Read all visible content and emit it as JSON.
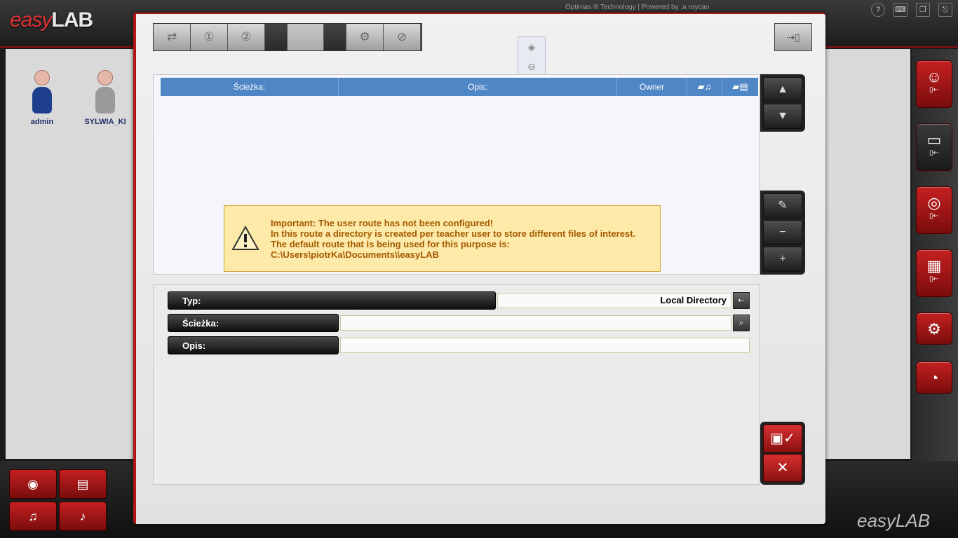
{
  "app": {
    "logo_easy": "easy",
    "logo_lab": "LAB",
    "credits": "Optimas ® Technology  |  Powered by ,a roycan",
    "bottom_logo": "easyLAB"
  },
  "desktop_users": [
    {
      "name": "admin",
      "body_color": "#1c3e8c"
    },
    {
      "name": "SYLWIA_KI",
      "body_color": "#9a9a9a"
    }
  ],
  "toolbar": {
    "buttons": [
      "users-swap-icon",
      "step-1-icon",
      "step-2-icon",
      "gear-icon",
      "gear-off-icon"
    ]
  },
  "grid": {
    "columns": [
      "Ścieżka:",
      "Opis:",
      "Owner"
    ],
    "header_color": "#4f86c6"
  },
  "warning": {
    "line1": "Important: The user route has not been configured!",
    "line2": "In this route a directory is created per teacher user to store different files of interest.",
    "line3": "The default route that is being used for this purpose is:",
    "line4": "C:\\Users\\piotrKa\\Documents\\\\easyLAB"
  },
  "form": {
    "typ_label": "Typ:",
    "typ_value": "Local Directory",
    "sciezka_label": "Ścieżka:",
    "sciezka_value": "",
    "opis_label": "Opis:",
    "opis_value": ""
  },
  "colors": {
    "accent_red": "#b01818",
    "warning_bg": "#fde9a8",
    "warning_text": "#a35a00"
  }
}
